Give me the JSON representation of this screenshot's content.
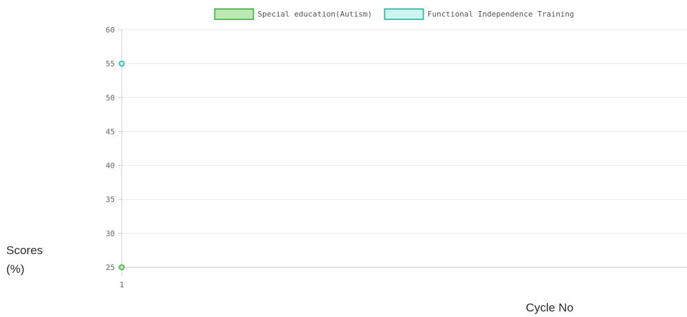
{
  "chart_data": {
    "type": "line",
    "title": "",
    "xlabel": "Cycle No",
    "ylabel": "Scores\n(%)",
    "categories": [
      "1"
    ],
    "ylim": [
      25,
      60
    ],
    "yticks": [
      "25",
      "30",
      "35",
      "40",
      "45",
      "50",
      "55",
      "60"
    ],
    "grid": true,
    "legend_position": "top",
    "series": [
      {
        "name": "Special education(Autism)",
        "values": [
          25
        ],
        "line_color": "#5cb85c",
        "fill_color": "#bde7b3"
      },
      {
        "name": "Functional Independence Training",
        "values": [
          55
        ],
        "line_color": "#4bc0b0",
        "fill_color": "#cdf5f0"
      }
    ]
  }
}
